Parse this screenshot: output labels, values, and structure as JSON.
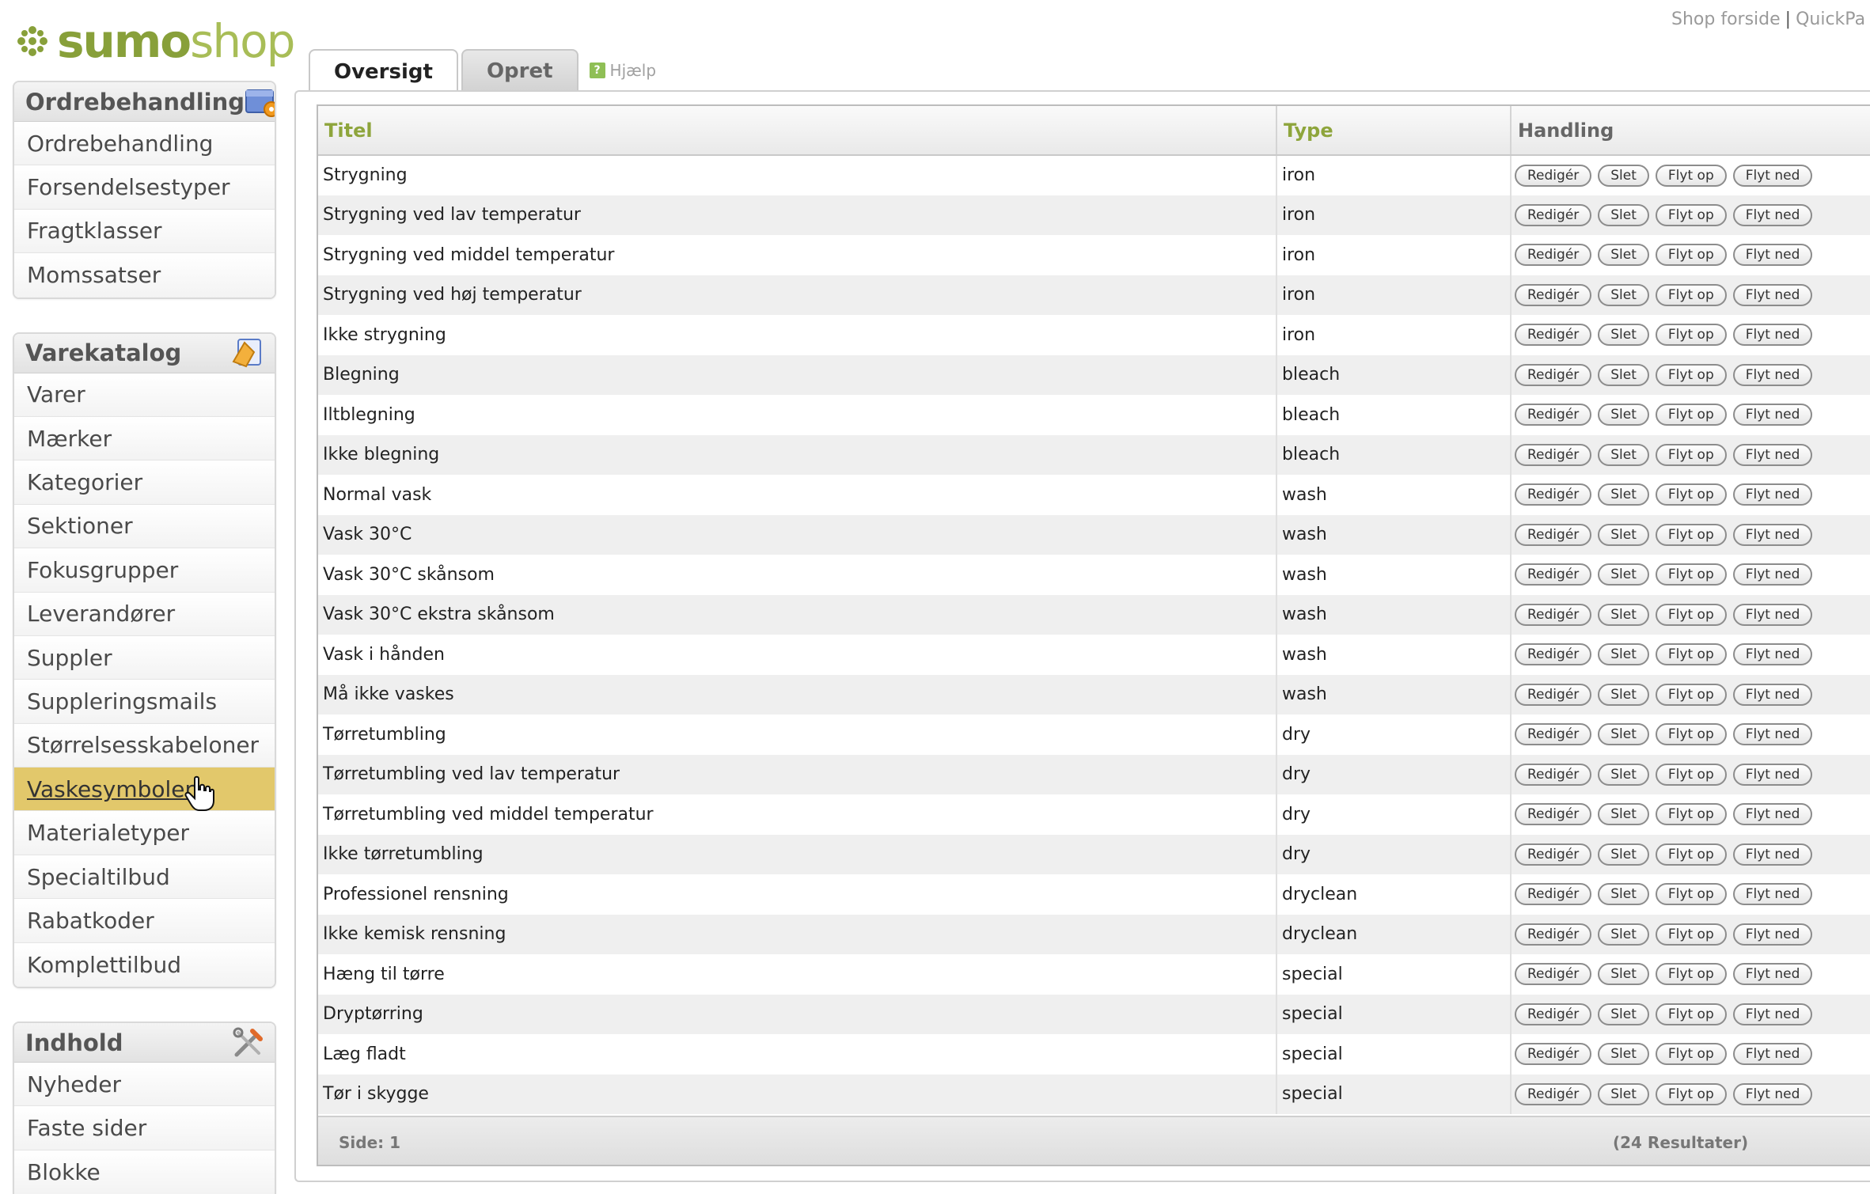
{
  "brand": {
    "logo_text_a": "sumo",
    "logo_text_b": "shop",
    "accent_color": "#88a03a",
    "active_nav_color": "#e2c86b"
  },
  "top_links": {
    "shop_forside": "Shop forside",
    "separator": "|",
    "quickpay": "QuickPa"
  },
  "sidebar": {
    "ordre": {
      "title": "Ordrebehandling",
      "icon": "order-box-icon",
      "items": [
        "Ordrebehandling",
        "Forsendelsestyper",
        "Fragtklasser",
        "Momssatser"
      ]
    },
    "vare": {
      "title": "Varekatalog",
      "icon": "catalog-icon",
      "items": [
        "Varer",
        "Mærker",
        "Kategorier",
        "Sektioner",
        "Fokusgrupper",
        "Leverandører",
        "Suppler",
        "Suppleringsmails",
        "Størrelsesskabeloner",
        "Vaskesymboler",
        "Materialetyper",
        "Specialtilbud",
        "Rabatkoder",
        "Komplettilbud"
      ],
      "active_item": "Vaskesymboler"
    },
    "indhold": {
      "title": "Indhold",
      "icon": "tools-icon",
      "items": [
        "Nyheder",
        "Faste sider",
        "Blokke"
      ]
    }
  },
  "tabs": {
    "overview": "Oversigt",
    "create": "Opret",
    "help": "Hjælp"
  },
  "table": {
    "headers": {
      "title": "Titel",
      "type": "Type",
      "actions": "Handling"
    },
    "action_labels": {
      "edit": "Redigér",
      "delete": "Slet",
      "move_up": "Flyt op",
      "move_down": "Flyt ned"
    },
    "rows": [
      {
        "title": "Strygning",
        "type": "iron"
      },
      {
        "title": "Strygning ved lav temperatur",
        "type": "iron"
      },
      {
        "title": "Strygning ved middel temperatur",
        "type": "iron"
      },
      {
        "title": "Strygning ved høj temperatur",
        "type": "iron"
      },
      {
        "title": "Ikke strygning",
        "type": "iron"
      },
      {
        "title": "Blegning",
        "type": "bleach"
      },
      {
        "title": "Iltblegning",
        "type": "bleach"
      },
      {
        "title": "Ikke blegning",
        "type": "bleach"
      },
      {
        "title": "Normal vask",
        "type": "wash"
      },
      {
        "title": "Vask 30°C",
        "type": "wash"
      },
      {
        "title": "Vask 30°C skånsom",
        "type": "wash"
      },
      {
        "title": "Vask 30°C ekstra skånsom",
        "type": "wash"
      },
      {
        "title": "Vask i hånden",
        "type": "wash"
      },
      {
        "title": "Må ikke vaskes",
        "type": "wash"
      },
      {
        "title": "Tørretumbling",
        "type": "dry"
      },
      {
        "title": "Tørretumbling ved lav temperatur",
        "type": "dry"
      },
      {
        "title": "Tørretumbling ved middel temperatur",
        "type": "dry"
      },
      {
        "title": "Ikke tørretumbling",
        "type": "dry"
      },
      {
        "title": "Professionel rensning",
        "type": "dryclean"
      },
      {
        "title": "Ikke kemisk rensning",
        "type": "dryclean"
      },
      {
        "title": "Hæng til tørre",
        "type": "special"
      },
      {
        "title": "Dryptørring",
        "type": "special"
      },
      {
        "title": "Læg fladt",
        "type": "special"
      },
      {
        "title": "Tør i skygge",
        "type": "special"
      }
    ],
    "footer": {
      "page": "Side: 1",
      "results": "(24 Resultater)"
    }
  }
}
